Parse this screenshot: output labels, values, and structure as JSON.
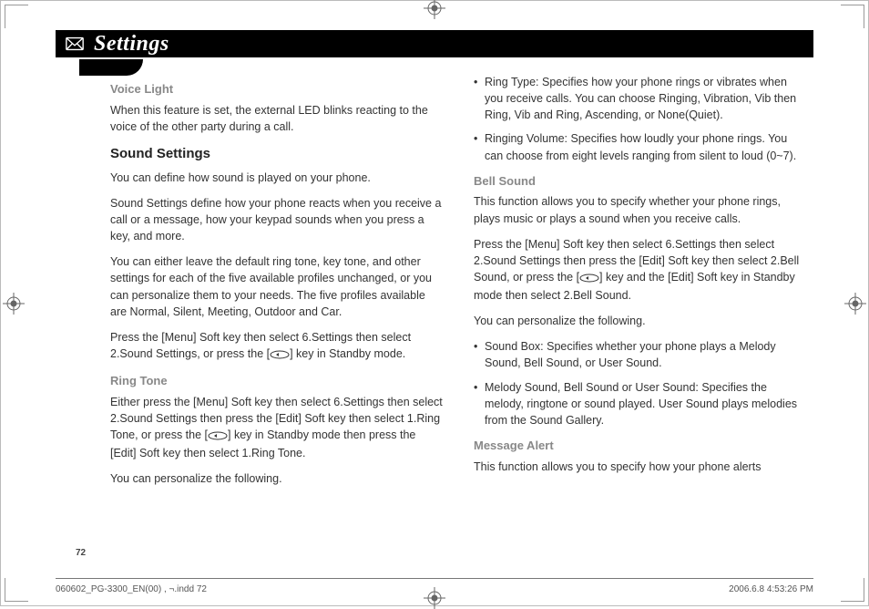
{
  "header": {
    "title": "Settings"
  },
  "col1": {
    "voice_light_h": "Voice Light",
    "voice_light_p": "When this feature is set, the external LED blinks reacting to the voice of the other party during a call.",
    "sound_settings_h": "Sound Settings",
    "ss_p1": "You can define how sound is played on your phone.",
    "ss_p2": "Sound Settings define how your phone reacts when you receive a call or a message, how your keypad sounds when you press a key, and more.",
    "ss_p3": "You can either leave the default ring tone, key tone, and other settings for each of the five available profiles unchanged, or you can personalize them to your needs. The five profiles available are Normal, Silent, Meeting, Outdoor and Car.",
    "ss_p4_a": "Press the [Menu] Soft key then select 6.Settings then select 2.Sound Settings, or press the [",
    "ss_p4_b": "] key in Standby mode.",
    "ring_tone_h": "Ring Tone",
    "rt_p1_a": "Either press the [Menu] Soft key then select 6.Settings then select 2.Sound Settings then press the [Edit] Soft key then select 1.Ring Tone, or press the [",
    "rt_p1_b": "] key in Standby mode then press the [Edit] Soft key then select 1.Ring Tone.",
    "rt_p2": "You can personalize the following."
  },
  "col2": {
    "bullets1": [
      "Ring Type: Specifies how your phone rings or vibrates when you receive calls. You can choose Ringing, Vibration, Vib then Ring, Vib and Ring, Ascending, or None(Quiet).",
      "Ringing Volume: Specifies how loudly your phone rings. You can choose from eight levels ranging from silent to loud (0~7)."
    ],
    "bell_sound_h": "Bell Sound",
    "bs_p1": "This function allows you to specify whether your phone rings, plays music or plays a sound when you receive calls.",
    "bs_p2_a": "Press the [Menu] Soft key then select 6.Settings then select 2.Sound Settings then press the [Edit] Soft key then select 2.Bell Sound, or press the [",
    "bs_p2_b": "] key and the [Edit] Soft key in Standby mode then select 2.Bell Sound.",
    "bs_p3": "You can personalize the following.",
    "bullets2": [
      "Sound Box: Specifies whether your phone plays a Melody Sound, Bell Sound, or User Sound.",
      "Melody Sound, Bell Sound or User Sound: Specifies the melody, ringtone or sound played. User Sound plays melodies from the Sound Gallery."
    ],
    "msg_alert_h": "Message Alert",
    "ma_p1": "This function allows you to specify how your phone alerts"
  },
  "page_number": "72",
  "footer": {
    "left": "060602_PG-3300_EN(00) , ¬.indd   72",
    "right": "2006.6.8   4:53:26 PM"
  }
}
